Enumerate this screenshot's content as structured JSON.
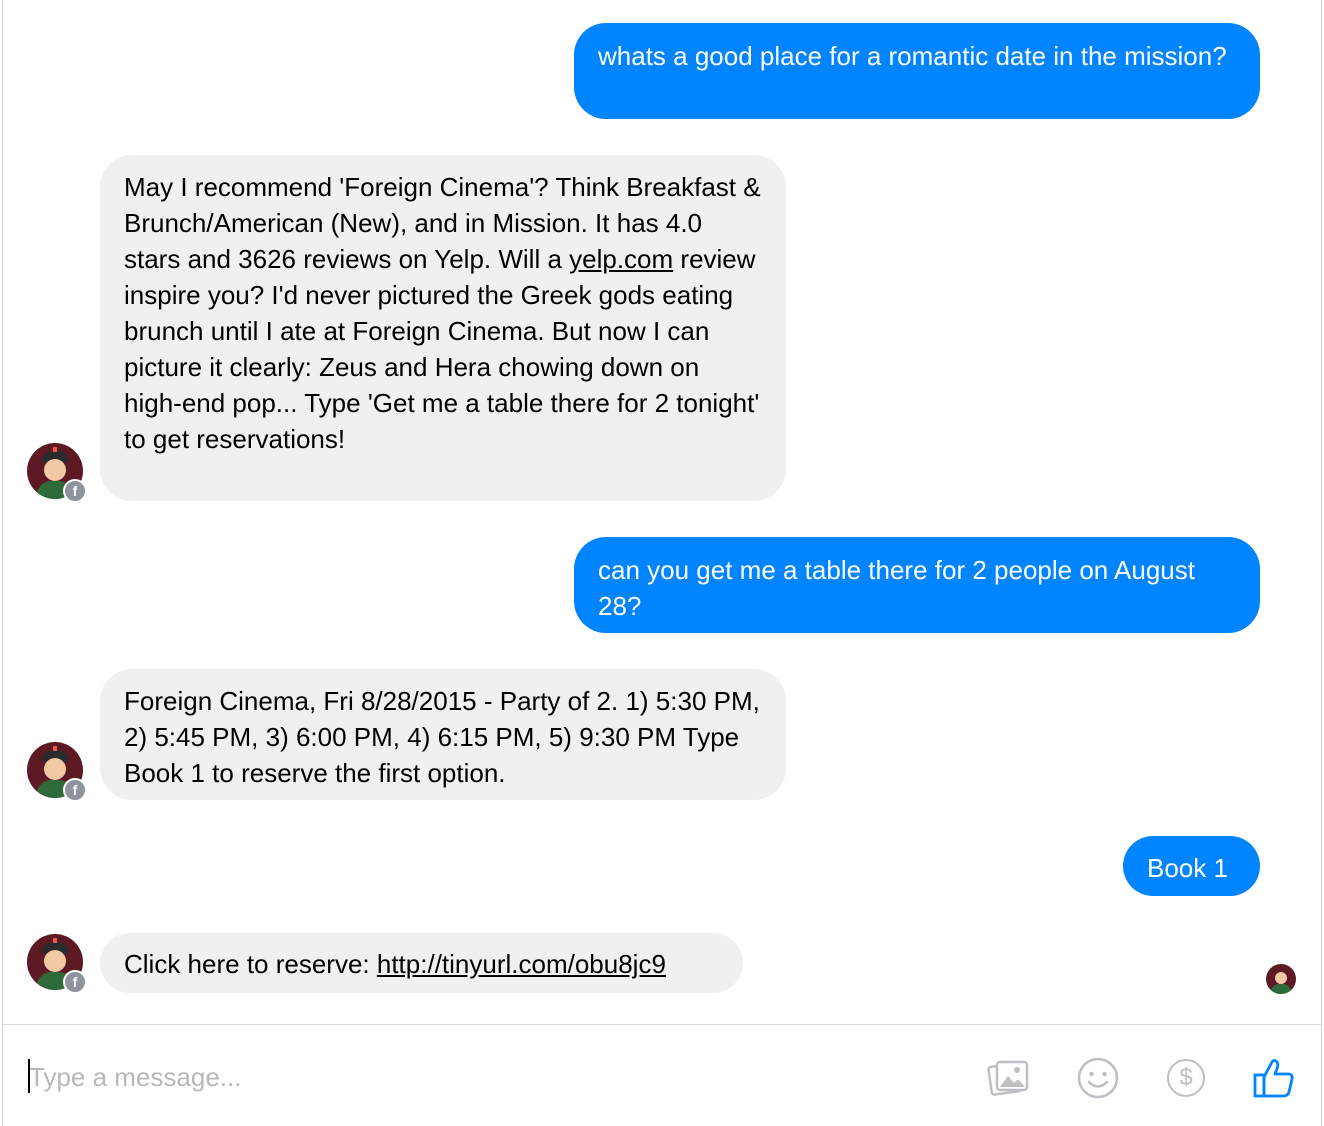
{
  "conversation": {
    "messages": [
      {
        "from": "user",
        "text": "whats a good place for a romantic date in the mission?"
      },
      {
        "from": "bot",
        "text_before": "May I recommend 'Foreign Cinema'? Think Breakfast & Brunch/American (New), and in Mission. It has 4.0 stars and 3626 reviews on Yelp.   Will a ",
        "link": "yelp.com",
        "text_after": " review inspire you? I'd never pictured the Greek gods eating brunch until I ate at Foreign Cinema. But now I can picture it clearly: Zeus and Hera chowing down on high-end pop...   Type 'Get me a table there for 2 tonight' to get reservations!"
      },
      {
        "from": "user",
        "text": "can you get me a table there for 2 people on August 28?"
      },
      {
        "from": "bot",
        "text": "Foreign Cinema, Fri 8/28/2015 - Party of 2.  1) 5:30 PM, 2) 5:45 PM, 3) 6:00 PM, 4) 6:15 PM, 5) 9:30 PM  Type Book 1 to reserve the first option."
      },
      {
        "from": "user",
        "text": "Book 1"
      },
      {
        "from": "bot",
        "text_before": "Click here to reserve: ",
        "link": "http://tinyurl.com/obu8jc9"
      }
    ]
  },
  "composer": {
    "placeholder": "Type a message...",
    "tools": [
      "photo-icon",
      "emoji-icon",
      "payment-icon",
      "like-icon"
    ],
    "payment_symbol": "$"
  },
  "colors": {
    "outgoing_bubble": "#0084ff",
    "incoming_bubble": "#f1f0f0",
    "like_blue": "#0084ff",
    "icon_gray": "#bcc0c4"
  }
}
